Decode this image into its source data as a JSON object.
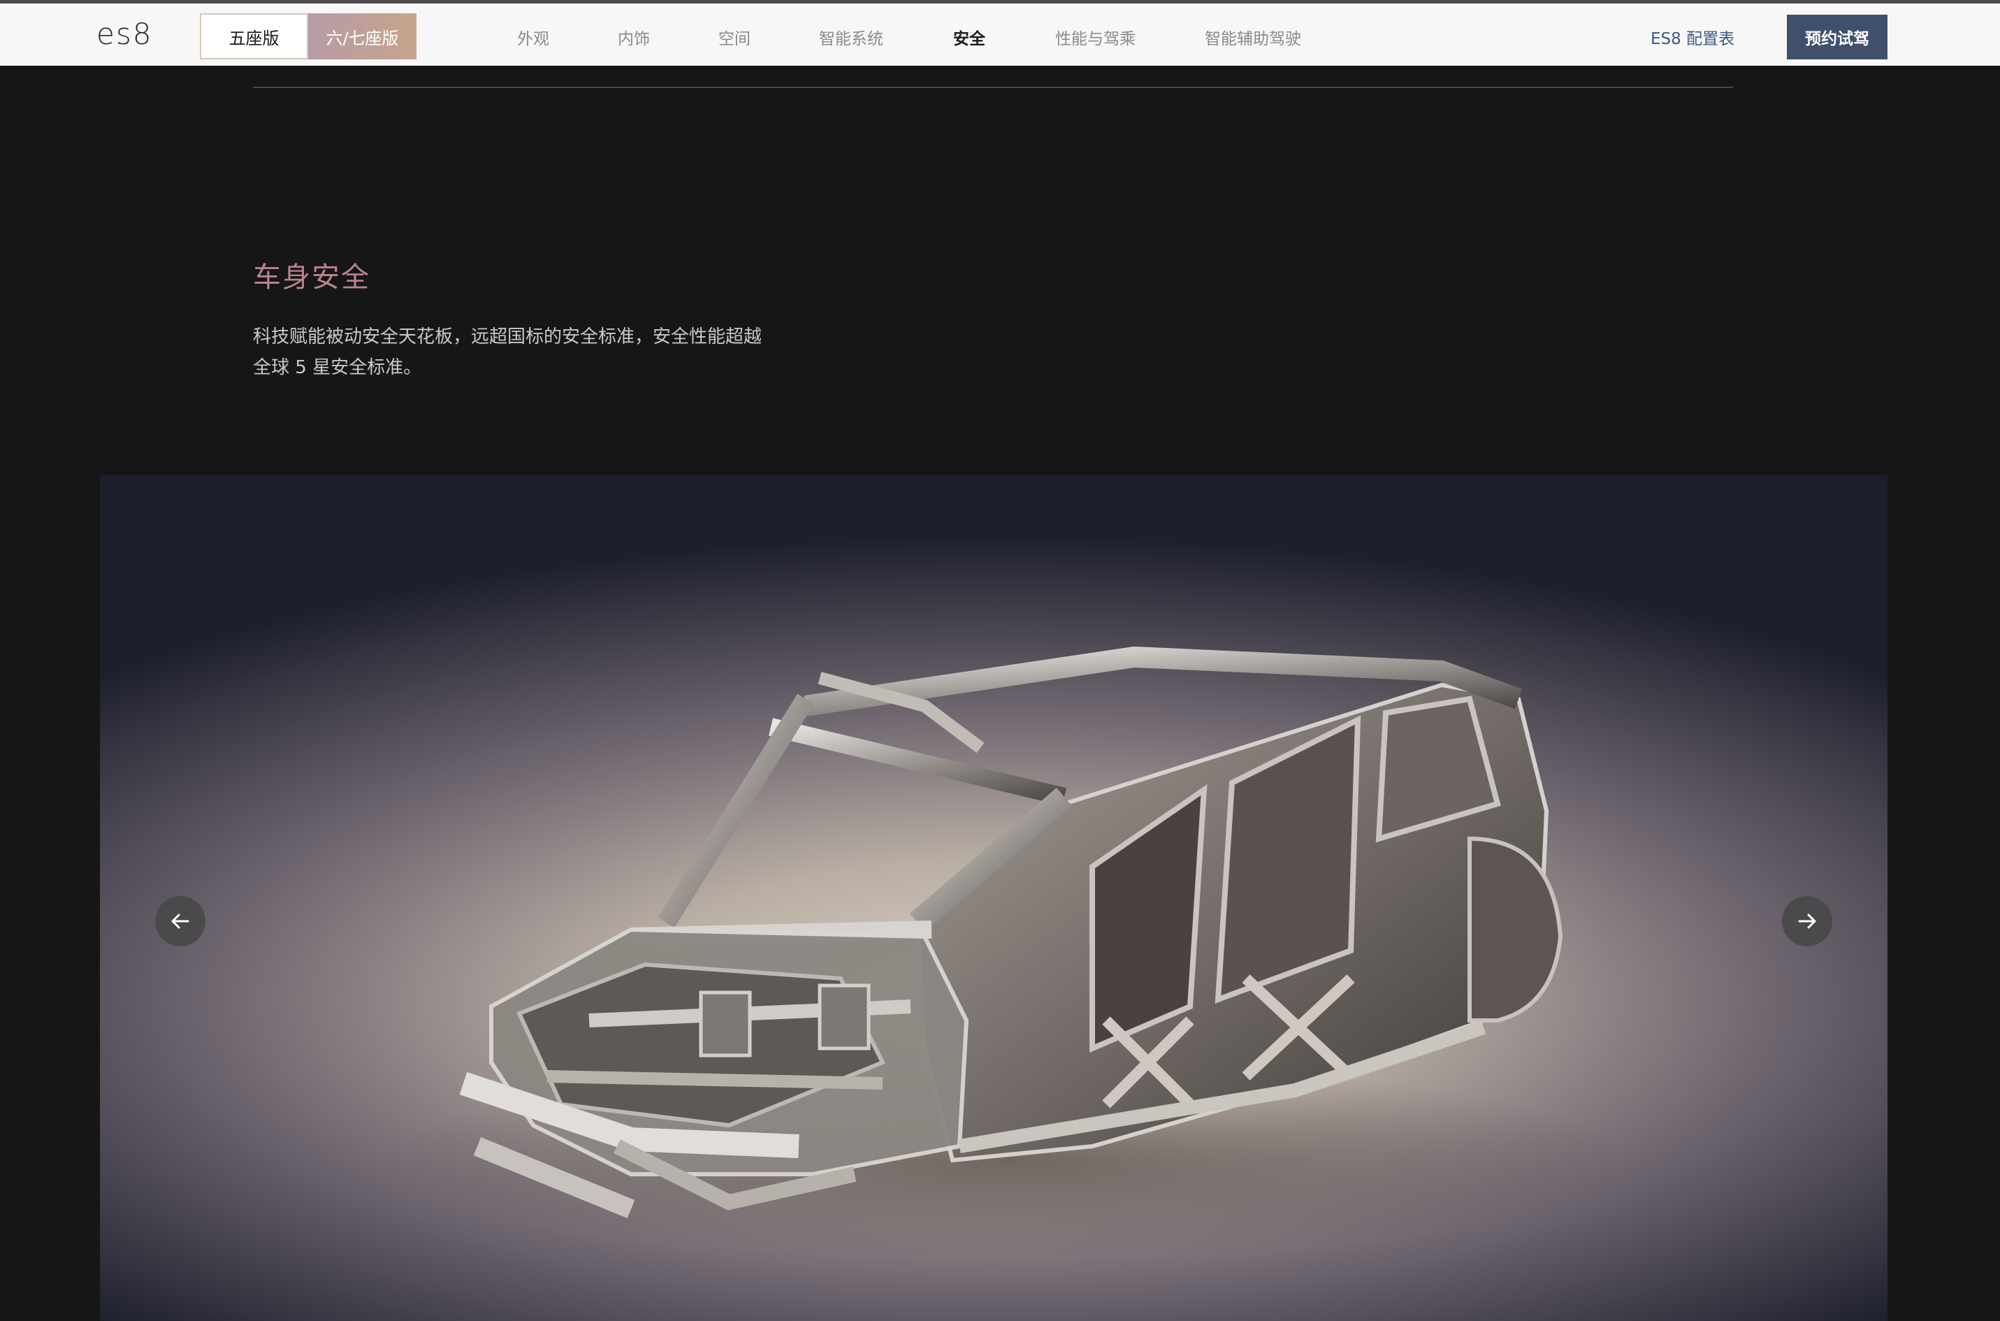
{
  "nav": {
    "logo": "es8",
    "seat_options": [
      "五座版",
      "六/七座版"
    ],
    "tabs": [
      "外观",
      "内饰",
      "空间",
      "智能系统",
      "安全",
      "性能与驾乘",
      "智能辅助驾驶"
    ],
    "active_tab": "安全",
    "spec_link": "ES8 配置表",
    "cta": "预约试驾"
  },
  "section": {
    "title": "车身安全",
    "description_line1": "科技赋能被动安全天花板，远超国标的安全标准，安全性能超越",
    "description_line2": "全球 5 星安全标准。"
  },
  "carousel": {
    "prev_icon": "arrow-left-icon",
    "next_icon": "arrow-right-icon"
  },
  "colors": {
    "title_accent": "#b8838f",
    "cta_background": "#3f506c",
    "spec_link": "#3a5a86"
  }
}
